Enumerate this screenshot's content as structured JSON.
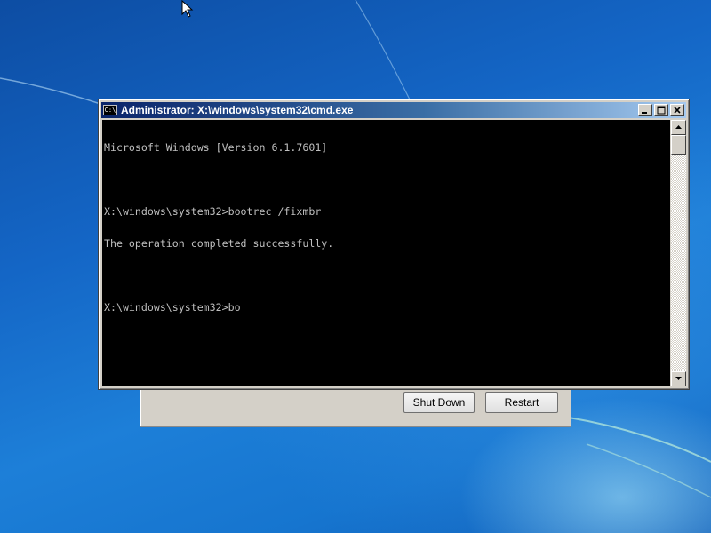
{
  "window": {
    "title": "Administrator: X:\\windows\\system32\\cmd.exe",
    "icon": "cmd-icon",
    "controls": [
      "minimize-icon",
      "maximize-icon",
      "close-icon"
    ]
  },
  "console": {
    "lines": [
      "Microsoft Windows [Version 6.1.7601]",
      "",
      "X:\\windows\\system32>bootrec /fixmbr",
      "The operation completed successfully.",
      "",
      "X:\\windows\\system32>bo"
    ],
    "text_color": "#c0c0c0",
    "background": "#000000"
  },
  "recovery_dialog": {
    "shutdown_label": "Shut Down",
    "restart_label": "Restart"
  },
  "colors": {
    "titlebar_start": "#0a246a",
    "titlebar_end": "#a6caf0",
    "desktop": "#1466c6"
  }
}
